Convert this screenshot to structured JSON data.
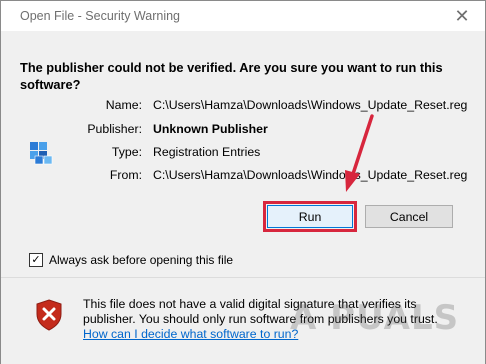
{
  "window": {
    "title": "Open File - Security Warning",
    "close_glyph": "✕"
  },
  "body": {
    "headline": "The publisher could not be verified.  Are you sure you want to run this software?",
    "icon": "registry-file-icon",
    "details": [
      {
        "label": "Name:",
        "value": "C:\\Users\\Hamza\\Downloads\\Windows_Update_Reset.reg",
        "bold": false
      },
      {
        "label": "Publisher:",
        "value": "Unknown Publisher",
        "bold": true
      },
      {
        "label": "Type:",
        "value": "Registration Entries",
        "bold": false
      },
      {
        "label": "From:",
        "value": "C:\\Users\\Hamza\\Downloads\\Windows_Update_Reset.reg",
        "bold": false
      }
    ],
    "buttons": {
      "run": "Run",
      "cancel": "Cancel"
    },
    "highlight_color": "#d7263d"
  },
  "checkbox": {
    "label": "Always ask before opening this file",
    "checked": true,
    "mark": "✓"
  },
  "footer": {
    "icon": "shield-warning-icon",
    "text": "This file does not have a valid digital signature that verifies its publisher.  You should only run software from publishers you trust.",
    "link": "How can I decide what software to run?"
  },
  "watermark": "A PUALS",
  "colors": {
    "accent": "#0078d7",
    "link": "#0066cc",
    "shield_red": "#c42b1c"
  }
}
